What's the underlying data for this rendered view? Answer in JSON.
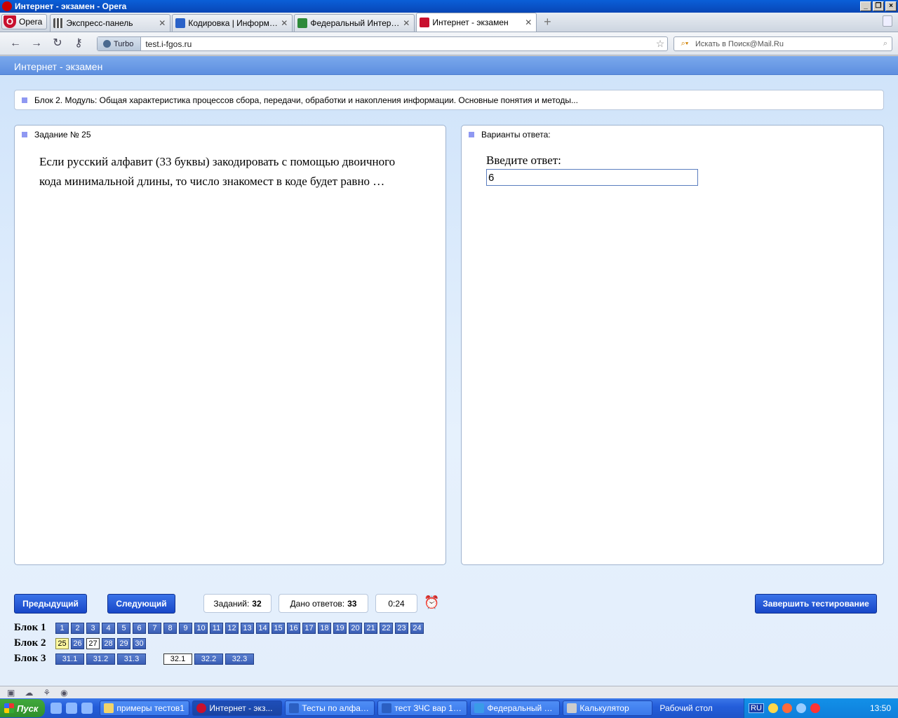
{
  "window": {
    "title": "Интернет - экзамен - Opera"
  },
  "browser": {
    "menu_label": "Opera",
    "tabs": [
      {
        "label": "Экспресс-панель",
        "active": false
      },
      {
        "label": "Кодировка | Информат...",
        "active": false
      },
      {
        "label": "Федеральный Интерне...",
        "active": false
      },
      {
        "label": "Интернет - экзамен",
        "active": true
      }
    ],
    "turbo_label": "Turbo",
    "address": "test.i-fgos.ru",
    "search_placeholder": "Искать в Поиск@Mail.Ru"
  },
  "page": {
    "header": "Интернет - экзамен",
    "block_title": "Блок 2. Модуль: Общая характеристика процессов сбора, передачи, обработки и накопления информации. Основные понятия и методы...",
    "task_title": "Задание № 25",
    "question": "Если русский алфавит (33 буквы) закодировать с помощью двоичного кода минимальной длины, то число знакомест в коде будет равно …",
    "answers_title": "Варианты ответа:",
    "answer_label": "Введите ответ:",
    "answer_value": "6",
    "prev_label": "Предыдущий",
    "next_label": "Следующий",
    "tasks_label": "Заданий:",
    "tasks_count": "32",
    "answered_label": "Дано ответов:",
    "answered_count": "33",
    "timer": "0:24",
    "finish_label": "Завершить тестирование",
    "blocks": [
      {
        "label": "Блок 1",
        "items": [
          "1",
          "2",
          "3",
          "4",
          "5",
          "6",
          "7",
          "8",
          "9",
          "10",
          "11",
          "12",
          "13",
          "14",
          "15",
          "16",
          "17",
          "18",
          "19",
          "20",
          "21",
          "22",
          "23",
          "24"
        ]
      },
      {
        "label": "Блок 2",
        "items": [
          "25",
          "26",
          "27",
          "28",
          "29",
          "30"
        ],
        "current": "25",
        "answered": [
          "27"
        ]
      },
      {
        "label": "Блок 3",
        "items": [
          "31.1",
          "31.2",
          "31.3",
          "32.1",
          "32.2",
          "32.3"
        ],
        "answered": [
          "32.1"
        ]
      }
    ]
  },
  "taskbar": {
    "start_label": "Пуск",
    "buttons": [
      {
        "label": "примеры тестов1",
        "active": false
      },
      {
        "label": "Интернет - экз...",
        "active": true
      },
      {
        "label": "Тесты по алфави...",
        "active": false
      },
      {
        "label": "тест ЗЧС вар 1.d...",
        "active": false
      },
      {
        "label": "Федеральный Ин...",
        "active": false
      },
      {
        "label": "Калькулятор",
        "active": false
      }
    ],
    "desktop_label": "Рабочий стол",
    "lang": "RU",
    "clock": "13:50"
  },
  "colors": {
    "accent": "#1747c8",
    "header": "#5d8fe0",
    "current": "#fff8a0"
  }
}
